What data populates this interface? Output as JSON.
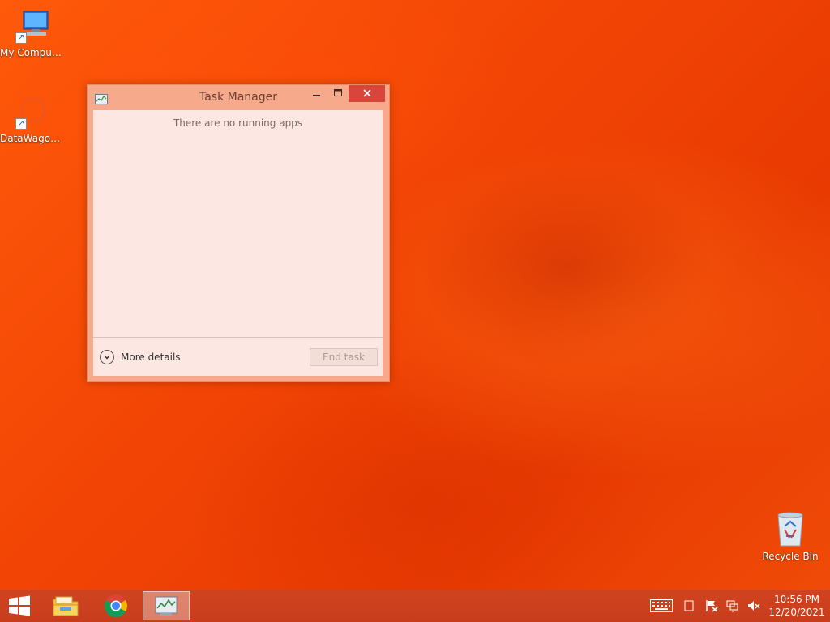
{
  "desktop": {
    "icons": [
      {
        "label": "My Computer"
      },
      {
        "label": "DataWagon..."
      },
      {
        "label": "Recycle Bin"
      }
    ]
  },
  "window": {
    "title": "Task Manager",
    "empty_message": "There are no running apps",
    "more_details_label": "More details",
    "end_task_label": "End task"
  },
  "taskbar": {
    "items": [
      "start-icon",
      "file-explorer-icon",
      "chrome-icon",
      "task-manager-icon"
    ],
    "tray": [
      "keyboard-icon",
      "notification-icon",
      "action-center-flag-icon",
      "network-icon",
      "volume-muted-icon"
    ],
    "time": "10:56 PM",
    "date": "12/20/2021"
  }
}
